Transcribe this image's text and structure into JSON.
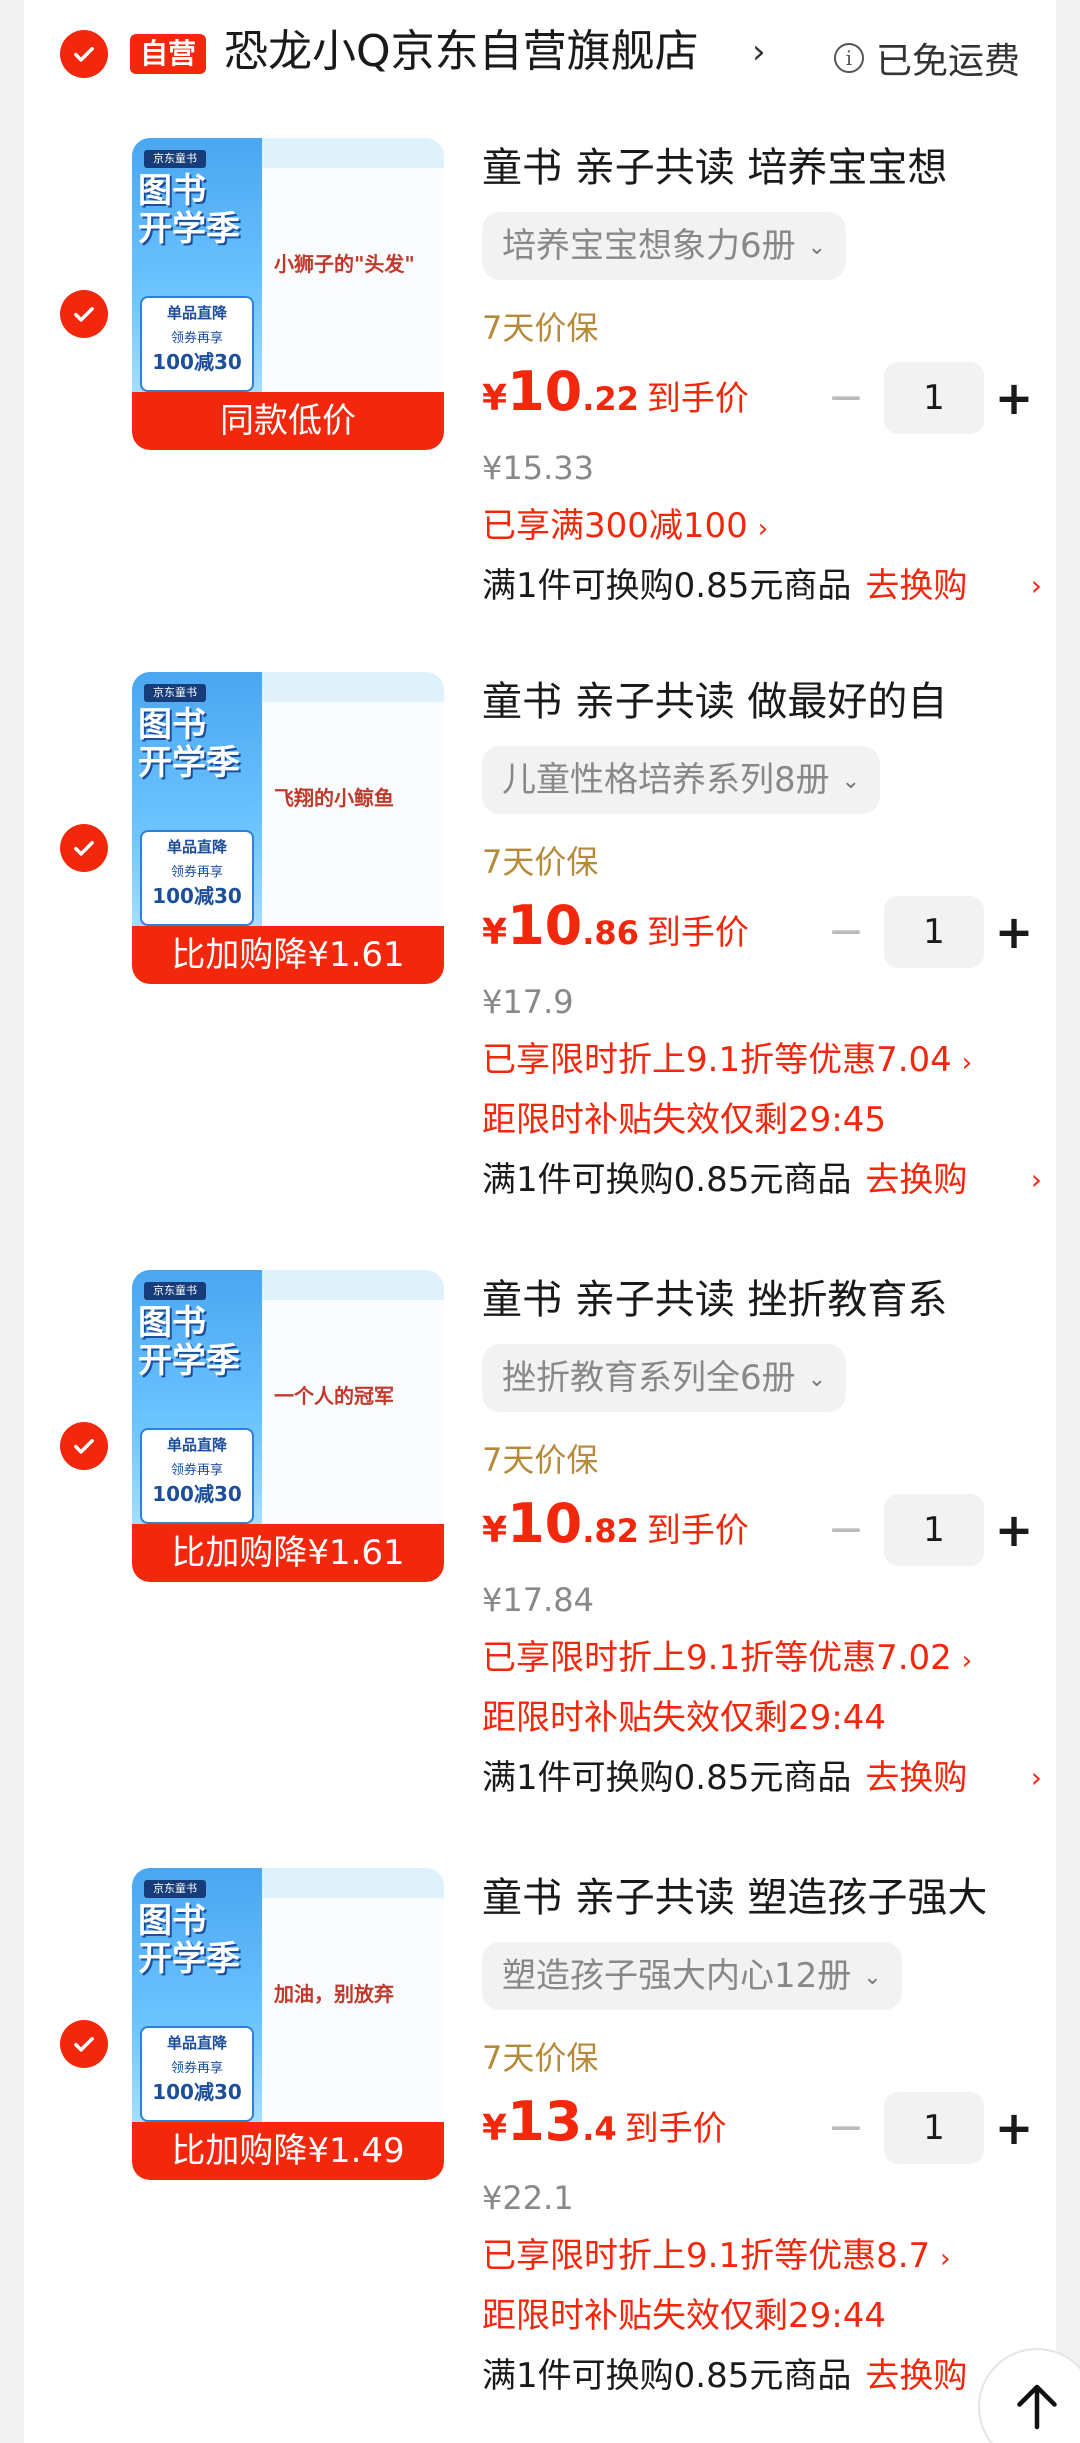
{
  "shop": {
    "badge": "自营",
    "name": "恐龙小Q京东自营旗舰店",
    "chevron": "›",
    "shipping": "已免运费",
    "info_glyph": "i"
  },
  "items": [
    {
      "title": "童书 亲子共读  培养宝宝想",
      "variant": "培养宝宝想象力6册",
      "guarantee": "7天价保",
      "price_yen": "¥",
      "price_int": "10",
      "price_dec": ".22",
      "price_suffix": "到手价",
      "qty": "1",
      "original_price": "¥15.33",
      "promos": [
        "已享满300减100"
      ],
      "exchange_text": "满1件可换购0.85元商品",
      "exchange_link": "去换购",
      "thumb_label": "同款低价",
      "book_title": "小狮子的\"头发\""
    },
    {
      "title": "童书 亲子共读  做最好的自",
      "variant": "儿童性格培养系列8册",
      "guarantee": "7天价保",
      "price_yen": "¥",
      "price_int": "10",
      "price_dec": ".86",
      "price_suffix": "到手价",
      "qty": "1",
      "original_price": "¥17.9",
      "promos": [
        "已享限时折上9.1折等优惠7.04",
        "距限时补贴失效仅剩29:45"
      ],
      "exchange_text": "满1件可换购0.85元商品",
      "exchange_link": "去换购",
      "thumb_label": "比加购降¥1.61",
      "book_title": "飞翔的小鲸鱼"
    },
    {
      "title": "童书 亲子共读  挫折教育系",
      "variant": "挫折教育系列全6册",
      "guarantee": "7天价保",
      "price_yen": "¥",
      "price_int": "10",
      "price_dec": ".82",
      "price_suffix": "到手价",
      "qty": "1",
      "original_price": "¥17.84",
      "promos": [
        "已享限时折上9.1折等优惠7.02",
        "距限时补贴失效仅剩29:44"
      ],
      "exchange_text": "满1件可换购0.85元商品",
      "exchange_link": "去换购",
      "thumb_label": "比加购降¥1.61",
      "book_title": "一个人的冠军"
    },
    {
      "title": "童书 亲子共读 塑造孩子强大",
      "variant": "塑造孩子强大内心12册",
      "guarantee": "7天价保",
      "price_yen": "¥",
      "price_int": "13",
      "price_dec": ".4",
      "price_suffix": "到手价",
      "qty": "1",
      "original_price": "¥22.1",
      "promos": [
        "已享限时折上9.1折等优惠8.7",
        "距限时补贴失效仅剩29:44"
      ],
      "exchange_text": "满1件可换购0.85元商品",
      "exchange_link": "去换购",
      "thumb_label": "比加购降¥1.49",
      "book_title": "加油，别放弃"
    }
  ],
  "thumb_common": {
    "tag": "京东童书",
    "title_line1": "图书",
    "title_line2": "开学季",
    "promo_l1": "单品直降",
    "promo_l2": "领券再享",
    "promo_l3": "100减30"
  },
  "glyphs": {
    "minus": "−",
    "plus": "+",
    "variant_chevron": "⌄",
    "link_chevron": "›"
  },
  "colors": {
    "brand_red": "#f2270c",
    "guarantee_gold": "#b58a3a",
    "muted_gray": "#888888"
  }
}
